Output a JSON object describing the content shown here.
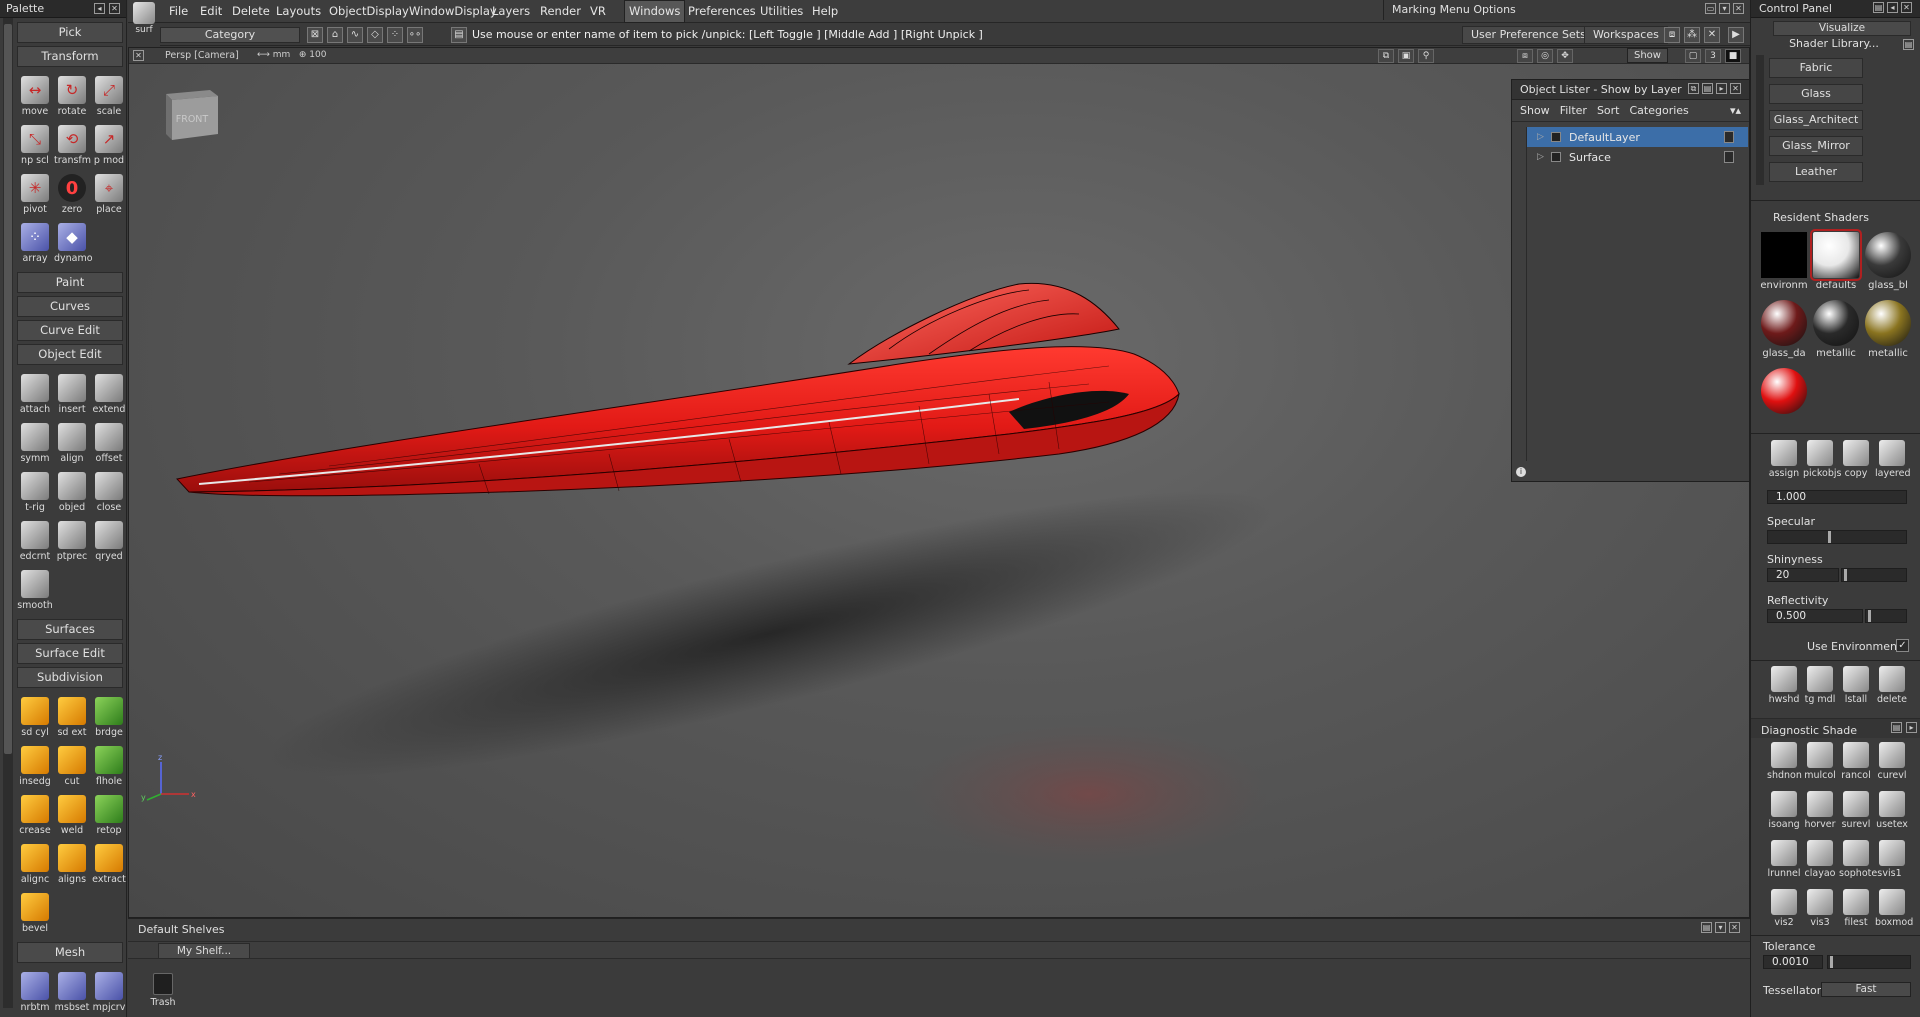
{
  "palette": {
    "title": "Palette",
    "pick": "Pick",
    "transform": "Transform",
    "transform_tools": [
      {
        "label": "move",
        "icon": "move-icon"
      },
      {
        "label": "rotate",
        "icon": "rotate-icon"
      },
      {
        "label": "scale",
        "icon": "scale-icon"
      },
      {
        "label": "np scl",
        "icon": "nonprop-scale-icon"
      },
      {
        "label": "transfm",
        "icon": "transform-icon"
      },
      {
        "label": "p mod",
        "icon": "pivot-modify-icon"
      },
      {
        "label": "pivot",
        "icon": "pivot-icon"
      },
      {
        "label": "zero",
        "icon": "zero-icon"
      },
      {
        "label": "place",
        "icon": "place-icon"
      },
      {
        "label": "array",
        "icon": "array-icon"
      },
      {
        "label": "dynamo",
        "icon": "dynamo-icon"
      }
    ],
    "paint": "Paint",
    "curves": "Curves",
    "curve_edit": "Curve Edit",
    "object_edit": "Object Edit",
    "object_edit_tools": [
      {
        "label": "attach"
      },
      {
        "label": "insert"
      },
      {
        "label": "extend"
      },
      {
        "label": "symm"
      },
      {
        "label": "align"
      },
      {
        "label": "offset"
      },
      {
        "label": "t-rig"
      },
      {
        "label": "objed"
      },
      {
        "label": "close"
      },
      {
        "label": "edcrnt"
      },
      {
        "label": "ptprec"
      },
      {
        "label": "qryed"
      },
      {
        "label": "smooth"
      }
    ],
    "surfaces": "Surfaces",
    "surface_edit": "Surface Edit",
    "subdivision": "Subdivision",
    "subdivision_tools": [
      {
        "label": "sd cyl"
      },
      {
        "label": "sd ext"
      },
      {
        "label": "brdge"
      },
      {
        "label": "insedg"
      },
      {
        "label": "cut"
      },
      {
        "label": "flhole"
      },
      {
        "label": "crease"
      },
      {
        "label": "weld"
      },
      {
        "label": "retop"
      },
      {
        "label": "alignc"
      },
      {
        "label": "aligns"
      },
      {
        "label": "extract"
      },
      {
        "label": "bevel"
      }
    ],
    "mesh": "Mesh",
    "mesh_tools": [
      {
        "label": "nrbtm"
      },
      {
        "label": "msbset"
      },
      {
        "label": "mpjcrv"
      }
    ]
  },
  "menubar": {
    "surf_label": "surf",
    "items": [
      "File",
      "Edit",
      "Delete",
      "Layouts",
      "ObjectDisplay",
      "WindowDisplay",
      "Layers",
      "Render",
      "VR",
      "Windows",
      "Preferences",
      "Utilities",
      "Help"
    ],
    "active": "Windows",
    "marking_menu": "Marking Menu Options"
  },
  "toolbar": {
    "category": "Category",
    "prompt": "Use mouse or enter name of item to pick /unpick: [Left Toggle ] [Middle Add ] [Right Unpick ]",
    "user_pref_sets": "User Preference Sets",
    "workspaces": "Workspaces"
  },
  "viewport": {
    "camera": "Persp [Camera]",
    "unit": "⟷ mm",
    "scale": "100",
    "show": "Show",
    "viewcube_label": "FRONT",
    "page_number": "3",
    "axis_z": "z",
    "axis_y": "y",
    "axis_x": "x"
  },
  "object_lister": {
    "title": "Object Lister - Show by Layer",
    "menu": [
      "Show",
      "Filter",
      "Sort",
      "Categories"
    ],
    "rows": [
      {
        "name": "DefaultLayer",
        "selected": true
      },
      {
        "name": "Surface",
        "selected": false
      }
    ]
  },
  "shelves": {
    "title": "Default Shelves",
    "tab": "My Shelf...",
    "trash": "Trash"
  },
  "control_panel": {
    "title": "Control Panel",
    "visualize": "Visualize",
    "shader_library": "Shader Library...",
    "library_items": [
      "Fabric",
      "Glass",
      "Glass_Architect",
      "Glass_Mirror",
      "Leather"
    ],
    "resident_shaders_title": "Resident Shaders",
    "shaders": [
      {
        "label": "environm",
        "color": "#000000"
      },
      {
        "label": "defaults",
        "color": "#e8e8e8"
      },
      {
        "label": "glass_bl",
        "color": "#3a3a3a"
      },
      {
        "label": "glass_da",
        "color": "#6e1a1a"
      },
      {
        "label": "metallic",
        "color": "#2a2a2a"
      },
      {
        "label": "metallic",
        "color": "#8a7420"
      },
      {
        "label": "",
        "color": "#e01010"
      }
    ],
    "shader_tools": [
      "assign",
      "pickobjs",
      "copy",
      "layered"
    ],
    "value_1": "1.000",
    "specular_label": "Specular",
    "shininess_label": "Shinyness",
    "shininess_value": "20",
    "reflectivity_label": "Reflectivity",
    "reflectivity_value": "0.500",
    "use_environment": "Use Environment",
    "render_tools": [
      "hwshd",
      "tg mdl",
      "lstall",
      "delete"
    ],
    "diagnostic_title": "Diagnostic Shade",
    "diagnostic_tools": [
      "shdnon",
      "mulcol",
      "rancol",
      "curevl",
      "isoang",
      "horver",
      "surevl",
      "usetex",
      "lrunnel",
      "clayao",
      "sophotes",
      "vis1",
      "vis2",
      "vis3",
      "filest",
      "boxmod"
    ],
    "tolerance_label": "Tolerance",
    "tolerance_value": "0.0010",
    "tessellator_label": "Tessellator",
    "tessellator_value": "Fast"
  },
  "colors": {
    "body_red": "#e02020",
    "selection_blue": "#3c6ea8",
    "panel_bg": "#3b3b3b"
  }
}
